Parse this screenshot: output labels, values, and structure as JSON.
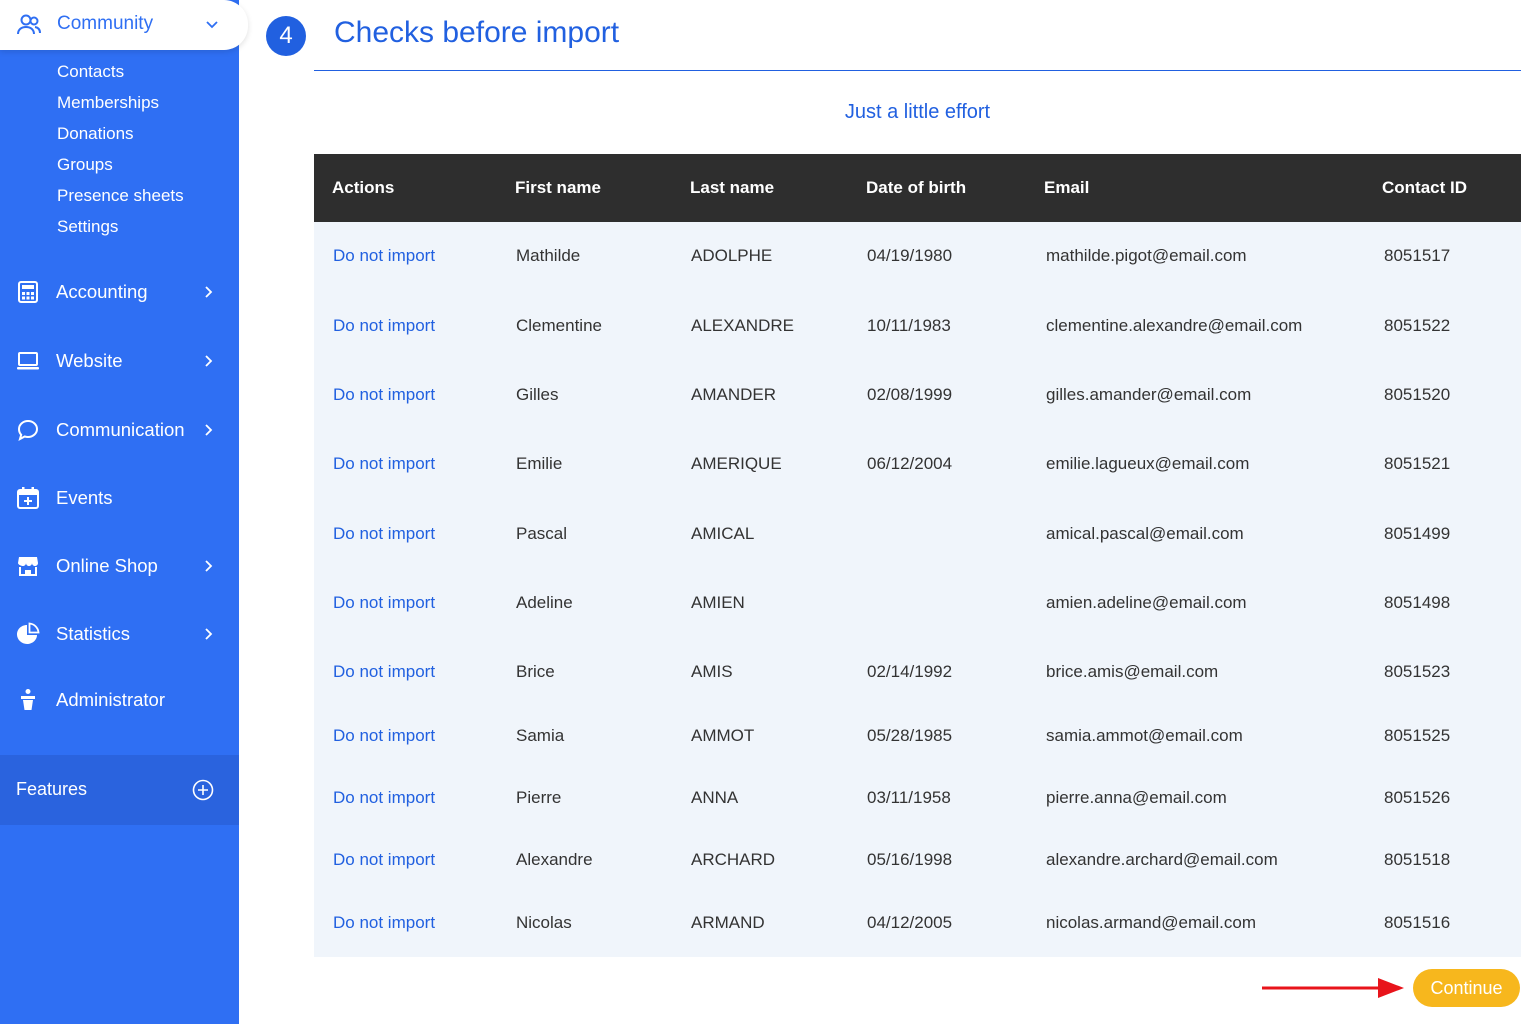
{
  "sidebar": {
    "community": {
      "label": "Community",
      "icon": "users-icon",
      "subitems": [
        "Contacts",
        "Memberships",
        "Donations",
        "Groups",
        "Presence sheets",
        "Settings"
      ]
    },
    "items": [
      {
        "label": "Accounting",
        "icon": "calculator-icon",
        "has_chevron": true
      },
      {
        "label": "Website",
        "icon": "laptop-icon",
        "has_chevron": true
      },
      {
        "label": "Communication",
        "icon": "chat-bubble-icon",
        "has_chevron": true
      },
      {
        "label": "Events",
        "icon": "calendar-plus-icon",
        "has_chevron": false
      },
      {
        "label": "Online Shop",
        "icon": "shop-icon",
        "has_chevron": true
      },
      {
        "label": "Statistics",
        "icon": "pie-chart-icon",
        "has_chevron": true
      },
      {
        "label": "Administrator",
        "icon": "admin-icon",
        "has_chevron": false
      }
    ],
    "features": {
      "label": "Features",
      "icon": "plus-circle-icon"
    }
  },
  "main": {
    "step_number": "4",
    "title": "Checks before import",
    "subtitle": "Just a little effort",
    "table": {
      "columns": [
        "Actions",
        "First name",
        "Last name",
        "Date of birth",
        "Email",
        "Contact ID"
      ],
      "rows": [
        {
          "action": "Do not import",
          "first_name": "Mathilde",
          "last_name": "ADOLPHE",
          "dob": "04/19/1980",
          "email": "mathilde.pigot@email.com",
          "contact_id": "8051517"
        },
        {
          "action": "Do not import",
          "first_name": "Clementine",
          "last_name": "ALEXANDRE",
          "dob": "10/11/1983",
          "email": "clementine.alexandre@email.com",
          "contact_id": "8051522"
        },
        {
          "action": "Do not import",
          "first_name": "Gilles",
          "last_name": "AMANDER",
          "dob": "02/08/1999",
          "email": "gilles.amander@email.com",
          "contact_id": "8051520"
        },
        {
          "action": "Do not import",
          "first_name": "Emilie",
          "last_name": "AMERIQUE",
          "dob": "06/12/2004",
          "email": "emilie.lagueux@email.com",
          "contact_id": "8051521"
        },
        {
          "action": "Do not import",
          "first_name": "Pascal",
          "last_name": "AMICAL",
          "dob": "",
          "email": "amical.pascal@email.com",
          "contact_id": "8051499"
        },
        {
          "action": "Do not import",
          "first_name": "Adeline",
          "last_name": "AMIEN",
          "dob": "",
          "email": "amien.adeline@email.com",
          "contact_id": "8051498"
        },
        {
          "action": "Do not import",
          "first_name": "Brice",
          "last_name": "AMIS",
          "dob": "02/14/1992",
          "email": "brice.amis@email.com",
          "contact_id": "8051523"
        },
        {
          "action": "Do not import",
          "first_name": "Samia",
          "last_name": "AMMOT",
          "dob": "05/28/1985",
          "email": "samia.ammot@email.com",
          "contact_id": "8051525"
        },
        {
          "action": "Do not import",
          "first_name": "Pierre",
          "last_name": "ANNA",
          "dob": "03/11/1958",
          "email": "pierre.anna@email.com",
          "contact_id": "8051526"
        },
        {
          "action": "Do not import",
          "first_name": "Alexandre",
          "last_name": "ARCHARD",
          "dob": "05/16/1998",
          "email": "alexandre.archard@email.com",
          "contact_id": "8051518"
        },
        {
          "action": "Do not import",
          "first_name": "Nicolas",
          "last_name": "ARMAND",
          "dob": "04/12/2005",
          "email": "nicolas.armand@email.com",
          "contact_id": "8051516"
        }
      ]
    },
    "continue_label": "Continue"
  },
  "colors": {
    "sidebar_bg": "#2f6ff3",
    "primary": "#2160e0",
    "table_header_bg": "#2e2e2e",
    "table_body_bg": "#f0f5fb",
    "continue_bg": "#f7b71d",
    "arrow": "#e8141b"
  }
}
